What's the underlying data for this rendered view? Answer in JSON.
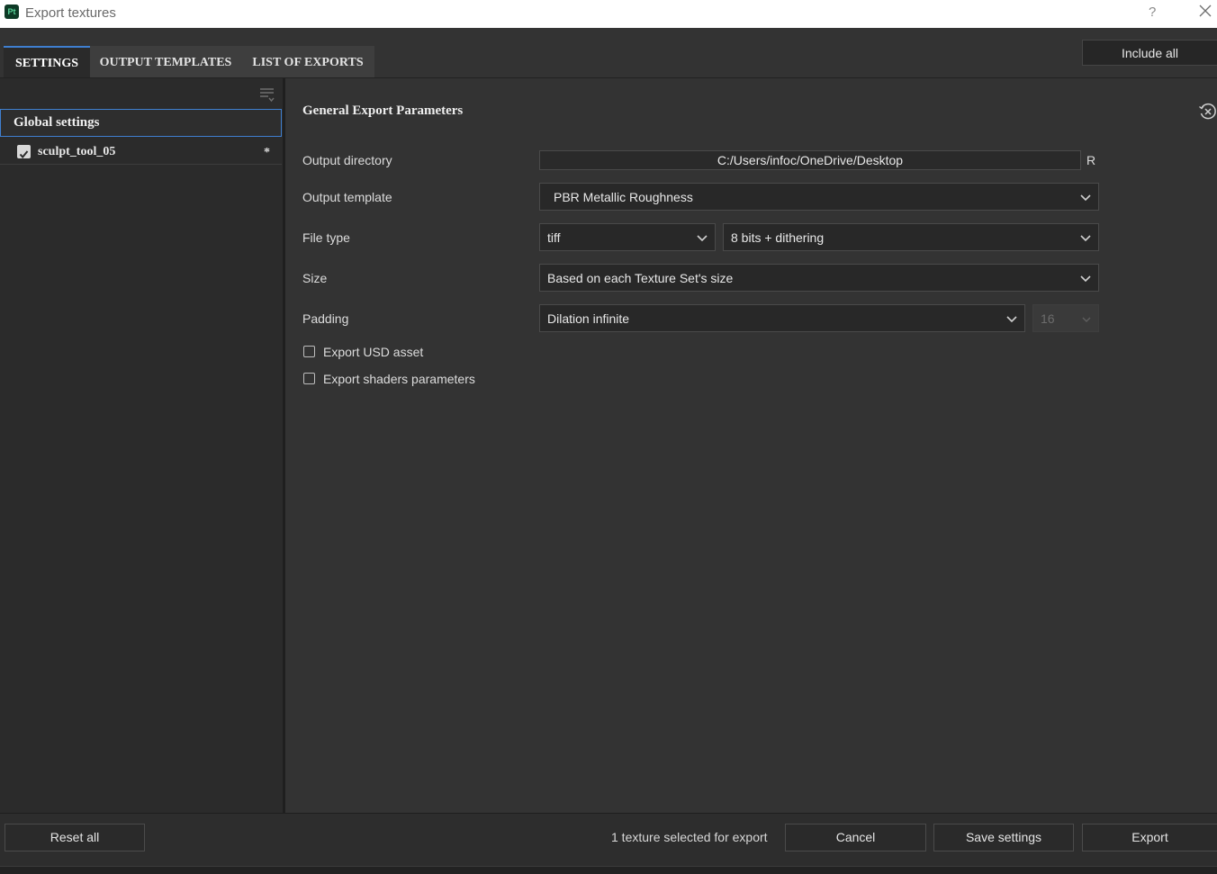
{
  "window": {
    "app_icon": "Pt",
    "title": "Export textures",
    "help_label": "?"
  },
  "tabs": [
    {
      "label": "SETTINGS",
      "active": true
    },
    {
      "label": "OUTPUT TEMPLATES",
      "active": false
    },
    {
      "label": "LIST OF EXPORTS",
      "active": false
    }
  ],
  "include_all_label": "Include all",
  "sidebar": {
    "global_label": "Global settings",
    "texture_sets": [
      {
        "name": "sculpt_tool_05",
        "checked": true,
        "modified_marker": "*"
      }
    ]
  },
  "main": {
    "title": "General Export Parameters",
    "output_directory": {
      "label": "Output directory",
      "value": "C:/Users/infoc/OneDrive/Desktop",
      "button_label": "R"
    },
    "output_template": {
      "label": "Output template",
      "value": "PBR Metallic Roughness"
    },
    "file_type": {
      "label": "File type",
      "format": "tiff",
      "bit_depth": "8 bits + dithering"
    },
    "size": {
      "label": "Size",
      "value": "Based on each Texture Set's size"
    },
    "padding": {
      "label": "Padding",
      "value": "Dilation infinite",
      "distance": "16"
    },
    "export_usd": {
      "label": "Export USD asset",
      "checked": false
    },
    "export_shaders": {
      "label": "Export shaders parameters",
      "checked": false
    }
  },
  "footer": {
    "reset_label": "Reset all",
    "status": "1 texture selected for export",
    "cancel_label": "Cancel",
    "save_label": "Save settings",
    "export_label": "Export"
  },
  "colors": {
    "accent": "#3f7fd0",
    "background": "#333333",
    "sidebar": "#2b2b2b"
  }
}
